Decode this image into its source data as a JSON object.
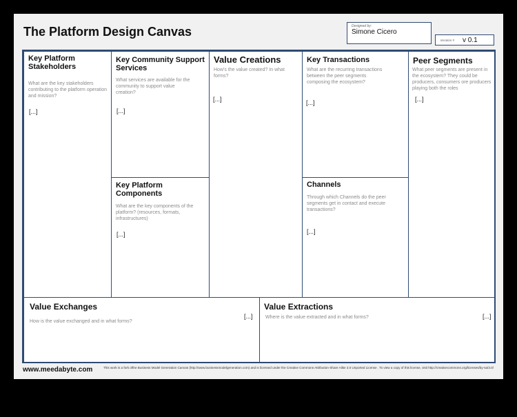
{
  "title": "The Platform Design Canvas",
  "designed_by": {
    "label": "Designed by:",
    "value": "Simone Cicero"
  },
  "version": {
    "label": "Iteration #",
    "value": "v 0.1"
  },
  "blocks": {
    "stakeholders": {
      "title": "Key Platform Stakeholders",
      "question": "What are the key stakeholders contributing to the platform operation and mission?",
      "placeholder": "[...]"
    },
    "support_services": {
      "title": "Key Community Support Services",
      "question": "What services are available for the community to support value creation?",
      "placeholder": "[...]"
    },
    "components": {
      "title": "Key Platform Components",
      "question": "What are the key components of the platform? (resources, formats, infrastructures)",
      "placeholder": "[...]"
    },
    "value_creations": {
      "title": "Value Creations",
      "question": "How's the value created? In what forms?",
      "placeholder": "[...]"
    },
    "transactions": {
      "title": "Key Transactions",
      "question": "What are the recurring transactions between the peer segments composing the ecosystem?",
      "placeholder": "[...]"
    },
    "channels": {
      "title": "Channels",
      "question": "Through which Channels do the peer segments get in contact and execute transactions?",
      "placeholder": "[...]"
    },
    "peer_segments": {
      "title": "Peer Segments",
      "question": "What peer segments are present in the ecosystem? They could be producers, consumers ore producers playing both the roles",
      "placeholder": "[...]"
    },
    "value_exchanges": {
      "title": "Value Exchanges",
      "question": "How is the value exchanged and in what forms?",
      "placeholder": "[...]"
    },
    "value_extractions": {
      "title": "Value Extractions",
      "question": "Where is the value extracted and in what forms?",
      "placeholder": "[...]"
    }
  },
  "footer": {
    "url": "www.meedabyte.com",
    "note": "This work is a fork ofthe Business Model Generation Canvas (http://www.businessmodelgeneration.com) and is licensed under the Creative Commons Attribution-Share Alike 3.0 Unported License . To view a copy of this license, visit http://creativecommons.org/licenses/by-sa/3.0/"
  }
}
